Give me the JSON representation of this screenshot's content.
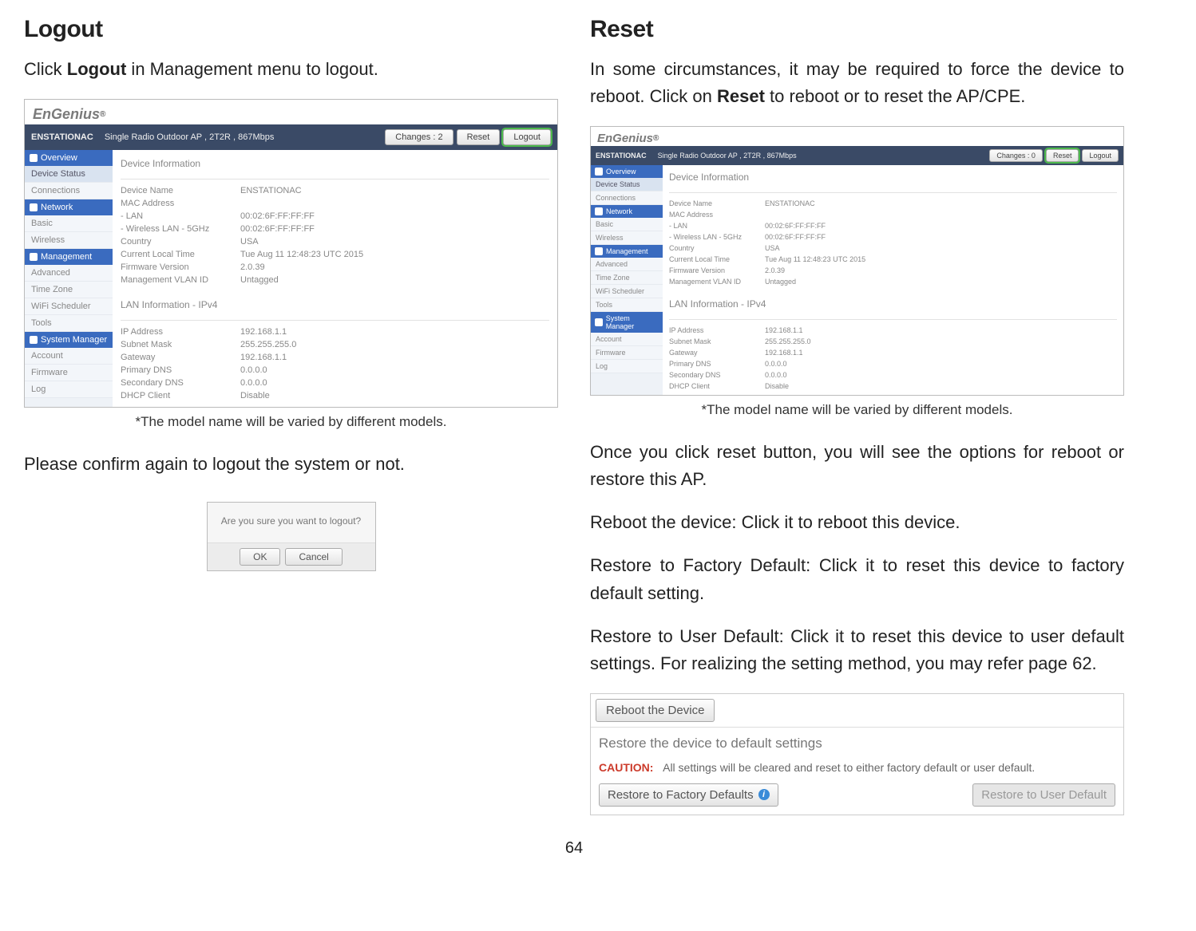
{
  "page_number": "64",
  "left": {
    "heading": "Logout",
    "intro_pre": "Click ",
    "intro_bold": "Logout",
    "intro_post": " in Management menu to logout.",
    "caption": "*The model name will be varied by different models.",
    "confirm_text": "Please confirm again to logout the system or not."
  },
  "right": {
    "heading": "Reset",
    "intro_pre": "In some circumstances, it may be required to force the device to reboot. Click on ",
    "intro_bold": "Reset",
    "intro_post": " to reboot or to reset the AP/CPE.",
    "caption": "*The model name will be varied by different models.",
    "p2": "Once you click reset button, you will see the options for reboot or restore this AP.",
    "p3": "Reboot the device: Click it to reboot this device.",
    "p4": "Restore to Factory Default: Click it to reset this device to factory default setting.",
    "p5": "Restore to User Default: Click it to reset this device to user default settings. For realizing the setting method, you may refer page 62."
  },
  "shot1": {
    "brand": "EnGenius",
    "model": "ENSTATIONAC",
    "desc": "Single Radio Outdoor AP , 2T2R , 867Mbps",
    "btn_changes": "Changes : 2",
    "btn_reset": "Reset",
    "btn_logout": "Logout",
    "side_sections": [
      {
        "hdr": "Overview",
        "items": [
          "Device Status",
          "Connections"
        ]
      },
      {
        "hdr": "Network",
        "items": [
          "Basic",
          "Wireless"
        ]
      },
      {
        "hdr": "Management",
        "items": [
          "Advanced",
          "Time Zone",
          "WiFi Scheduler",
          "Tools"
        ]
      },
      {
        "hdr": "System Manager",
        "items": [
          "Account",
          "Firmware",
          "Log"
        ]
      }
    ],
    "section1_title": "Device Information",
    "kv1": [
      {
        "k": "Device Name",
        "v": "ENSTATIONAC"
      },
      {
        "k": "MAC Address",
        "v": ""
      },
      {
        "k": "   - LAN",
        "v": "00:02:6F:FF:FF:FF"
      },
      {
        "k": "   - Wireless LAN - 5GHz",
        "v": "00:02:6F:FF:FF:FF"
      },
      {
        "k": "Country",
        "v": "USA"
      },
      {
        "k": "Current Local Time",
        "v": "Tue Aug 11 12:48:23 UTC 2015"
      },
      {
        "k": "Firmware Version",
        "v": "2.0.39"
      },
      {
        "k": "Management VLAN ID",
        "v": "Untagged"
      }
    ],
    "section2_title": "LAN Information - IPv4",
    "kv2": [
      {
        "k": "IP Address",
        "v": "192.168.1.1"
      },
      {
        "k": "Subnet Mask",
        "v": "255.255.255.0"
      },
      {
        "k": "Gateway",
        "v": "192.168.1.1"
      },
      {
        "k": "Primary DNS",
        "v": "0.0.0.0"
      },
      {
        "k": "Secondary DNS",
        "v": "0.0.0.0"
      },
      {
        "k": "DHCP Client",
        "v": "Disable"
      }
    ]
  },
  "shot2": {
    "brand": "EnGenius",
    "model": "ENSTATIONAC",
    "desc": "Single Radio Outdoor AP , 2T2R , 867Mbps",
    "btn_changes": "Changes : 0",
    "btn_reset": "Reset",
    "btn_logout": "Logout",
    "side_sections": [
      {
        "hdr": "Overview",
        "items": [
          "Device Status",
          "Connections"
        ]
      },
      {
        "hdr": "Network",
        "items": [
          "Basic",
          "Wireless"
        ]
      },
      {
        "hdr": "Management",
        "items": [
          "Advanced",
          "Time Zone",
          "WiFi Scheduler",
          "Tools"
        ]
      },
      {
        "hdr": "System Manager",
        "items": [
          "Account",
          "Firmware",
          "Log"
        ]
      }
    ],
    "section1_title": "Device Information",
    "kv1": [
      {
        "k": "Device Name",
        "v": "ENSTATIONAC"
      },
      {
        "k": "MAC Address",
        "v": ""
      },
      {
        "k": "   - LAN",
        "v": "00:02:6F:FF:FF:FF"
      },
      {
        "k": "   - Wireless LAN - 5GHz",
        "v": "00:02:6F:FF:FF:FF"
      },
      {
        "k": "Country",
        "v": "USA"
      },
      {
        "k": "Current Local Time",
        "v": "Tue Aug 11 12:48:23 UTC 2015"
      },
      {
        "k": "Firmware Version",
        "v": "2.0.39"
      },
      {
        "k": "Management VLAN ID",
        "v": "Untagged"
      }
    ],
    "section2_title": "LAN Information - IPv4",
    "kv2": [
      {
        "k": "IP Address",
        "v": "192.168.1.1"
      },
      {
        "k": "Subnet Mask",
        "v": "255.255.255.0"
      },
      {
        "k": "Gateway",
        "v": "192.168.1.1"
      },
      {
        "k": "Primary DNS",
        "v": "0.0.0.0"
      },
      {
        "k": "Secondary DNS",
        "v": "0.0.0.0"
      },
      {
        "k": "DHCP Client",
        "v": "Disable"
      }
    ]
  },
  "confirm": {
    "msg": "Are you sure you want to logout?",
    "ok": "OK",
    "cancel": "Cancel"
  },
  "reboot_panel": {
    "reboot_btn": "Reboot the Device",
    "restore_title": "Restore the device to default settings",
    "caution_label": "CAUTION:",
    "caution_text": "All settings will be cleared and reset to either factory default or user default.",
    "restore_factory": "Restore to Factory Defaults",
    "restore_user": "Restore to User Default"
  }
}
